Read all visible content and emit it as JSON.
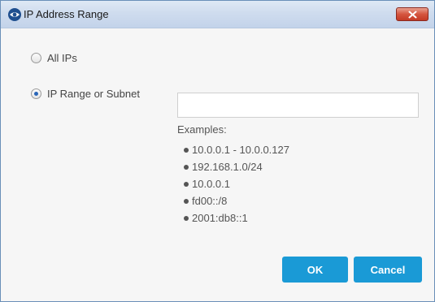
{
  "window": {
    "title": "IP Address Range",
    "app_icon": "eye-icon",
    "close_icon": "close-x-icon"
  },
  "options": {
    "all_ips_label": "All IPs",
    "all_ips_selected": false,
    "ip_range_label": "IP Range or Subnet",
    "ip_range_selected": true
  },
  "range_input": {
    "value": ""
  },
  "examples": {
    "label": "Examples:",
    "items": [
      "10.0.0.1 - 10.0.0.127",
      "192.168.1.0/24",
      "10.0.0.1",
      "fd00::/8",
      "2001:db8::1"
    ]
  },
  "buttons": {
    "ok_label": "OK",
    "cancel_label": "Cancel"
  },
  "colors": {
    "button_bg": "#1a9ad6",
    "radio_selected": "#2a66b8",
    "close_button": "#c43a25"
  }
}
